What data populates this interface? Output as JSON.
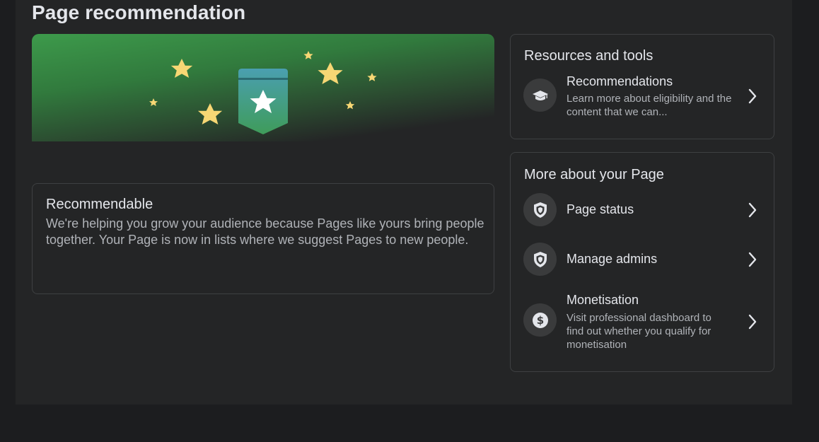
{
  "page": {
    "title": "Page recommendation"
  },
  "status": {
    "title": "Recommendable",
    "description": "We're helping you grow your audience because Pages like yours bring people together. Your Page is now in lists where we suggest Pages to new people."
  },
  "resources": {
    "heading": "Resources and tools",
    "items": [
      {
        "title": "Recommendations",
        "subtitle": "Learn more about eligibility and the content that we can...",
        "icon": "graduation-cap-icon"
      }
    ]
  },
  "more": {
    "heading": "More about your Page",
    "items": [
      {
        "title": "Page status",
        "icon": "shield-icon"
      },
      {
        "title": "Manage admins",
        "icon": "shield-icon"
      },
      {
        "title": "Monetisation",
        "subtitle": "Visit professional dashboard to find out whether you qualify for monetisation",
        "icon": "dollar-icon"
      }
    ]
  },
  "colors": {
    "background": "#1c1d1f",
    "panel": "#242526",
    "banner_green": "#3d9a4b",
    "star": "#f7d774",
    "badge_top": "#4a9fb0",
    "badge_bottom": "#3f9c5a"
  }
}
